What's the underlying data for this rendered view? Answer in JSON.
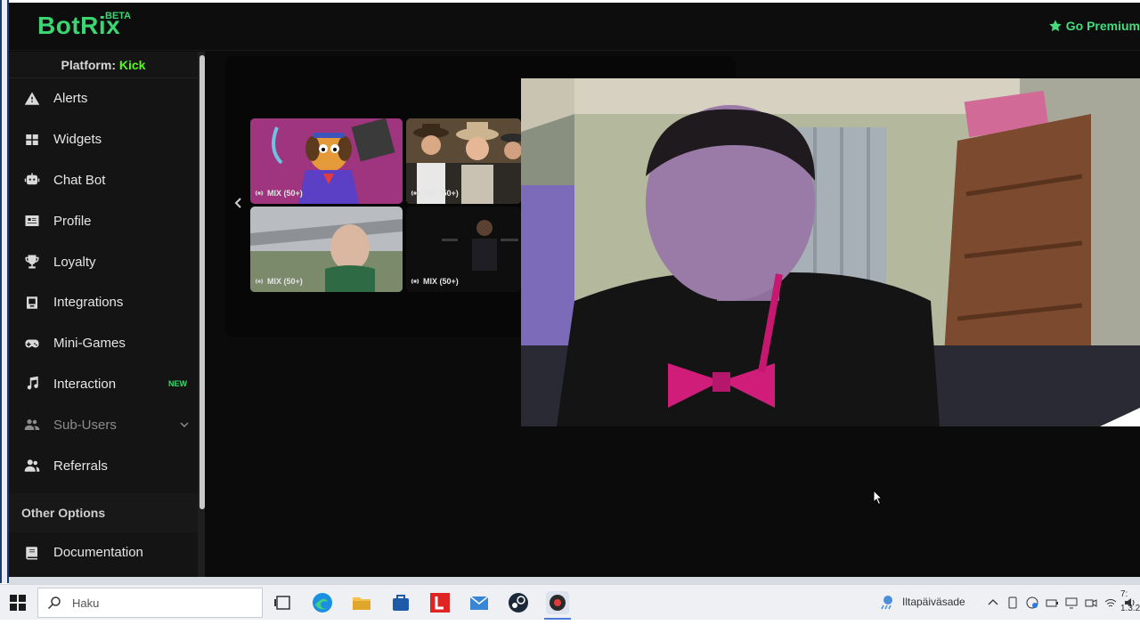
{
  "header": {
    "logo_text": "BotRix",
    "beta_label": "BETA",
    "premium_label": "Go Premium"
  },
  "sidebar": {
    "platform_label": "Platform:",
    "platform_value": "Kick",
    "items": [
      {
        "label": "Alerts",
        "icon": "warning-icon"
      },
      {
        "label": "Widgets",
        "icon": "grid-icon"
      },
      {
        "label": "Chat Bot",
        "icon": "robot-icon"
      },
      {
        "label": "Profile",
        "icon": "id-card-icon"
      },
      {
        "label": "Loyalty",
        "icon": "trophy-icon"
      },
      {
        "label": "Integrations",
        "icon": "integrations-icon"
      },
      {
        "label": "Mini-Games",
        "icon": "gamepad-icon"
      },
      {
        "label": "Interaction",
        "icon": "music-icon",
        "badge": "NEW"
      },
      {
        "label": "Sub-Users",
        "icon": "users-icon"
      },
      {
        "label": "Referrals",
        "icon": "referrals-icon"
      }
    ],
    "other_options_title": "Other Options",
    "documentation_label": "Documentation"
  },
  "media": {
    "tiles": [
      {
        "caption": "MIX (50+)"
      },
      {
        "caption": "MIX (50+)"
      },
      {
        "caption": "MIX (50+)"
      },
      {
        "caption": "MIX (50+)"
      }
    ]
  },
  "taskbar": {
    "search_placeholder": "Haku",
    "weather_text": "Iltapäiväsade",
    "clock_time": "7:",
    "clock_date": "1.3.2"
  },
  "colors": {
    "brand_green": "#3bd672",
    "kick_green": "#53fc18",
    "page_bg": "#0b0b0b",
    "sidebar_bg": "#141414"
  }
}
